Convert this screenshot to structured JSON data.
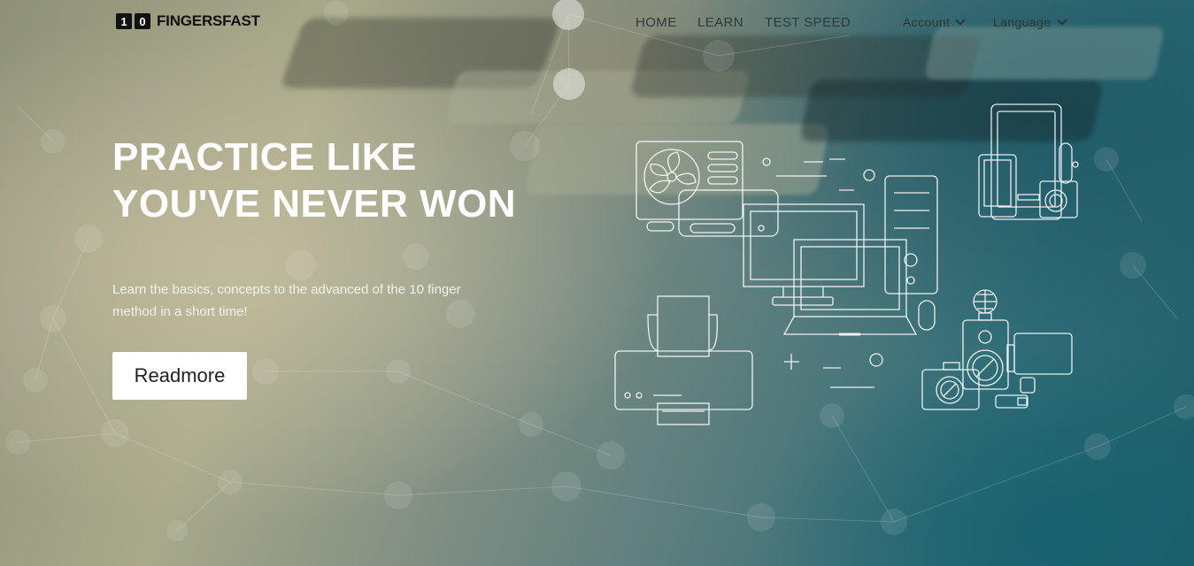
{
  "brand": {
    "digit_1": "1",
    "digit_2": "0",
    "name": "FINGERSFAST"
  },
  "nav": {
    "home": "HOME",
    "learn": "LEARN",
    "test_speed": "TEST SPEED",
    "account": "Account",
    "language": "Language"
  },
  "hero": {
    "title_line1": "PRACTICE LIKE",
    "title_line2": "YOU'VE NEVER WON",
    "subtitle_line1": "Learn the basics, concepts to the advanced of the 10 finger",
    "subtitle_line2": "method in a short time!",
    "button": "Readmore"
  },
  "colors": {
    "illustration_stroke": "#ffffff",
    "button_bg": "#ffffff",
    "title_text": "#ffffff"
  }
}
